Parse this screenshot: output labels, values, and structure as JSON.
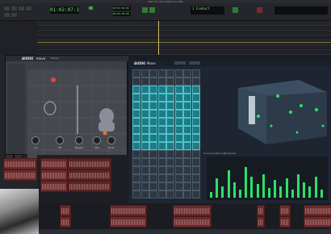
{
  "window": {
    "title": "Edit: Pro Tools 2020.12.1948"
  },
  "transport": {
    "main_counter": "01:02:07:18",
    "sub_counter_1": "00:00:00:00",
    "sub_counter_2": "00:00:00:00",
    "right_label": "1 Conduct"
  },
  "plugin": {
    "brand": "AUDIO",
    "brand_suffix": "move",
    "tabs": [
      "Stereo"
    ],
    "knobs": [
      "L R",
      "F B",
      "Height",
      "Size",
      "Inner",
      "Outer"
    ]
  },
  "right_panel": {
    "brand": "AUDIO",
    "brand_suffix": "Move",
    "mixer_label": "Surround Panning",
    "view_label": "Overview",
    "meter_count": 20,
    "meter_levels": [
      0.15,
      0.5,
      0.3,
      0.7,
      0.4,
      0.2,
      0.8,
      0.55,
      0.35,
      0.6,
      0.25,
      0.45,
      0.3,
      0.5,
      0.2,
      0.6,
      0.4,
      0.3,
      0.55,
      0.2
    ]
  },
  "colors": {
    "accent_cyan": "#4fc3c8",
    "clip_red": "#6a2a2a",
    "counter_green": "#7fe07a",
    "sphere_green": "#2de06a"
  }
}
